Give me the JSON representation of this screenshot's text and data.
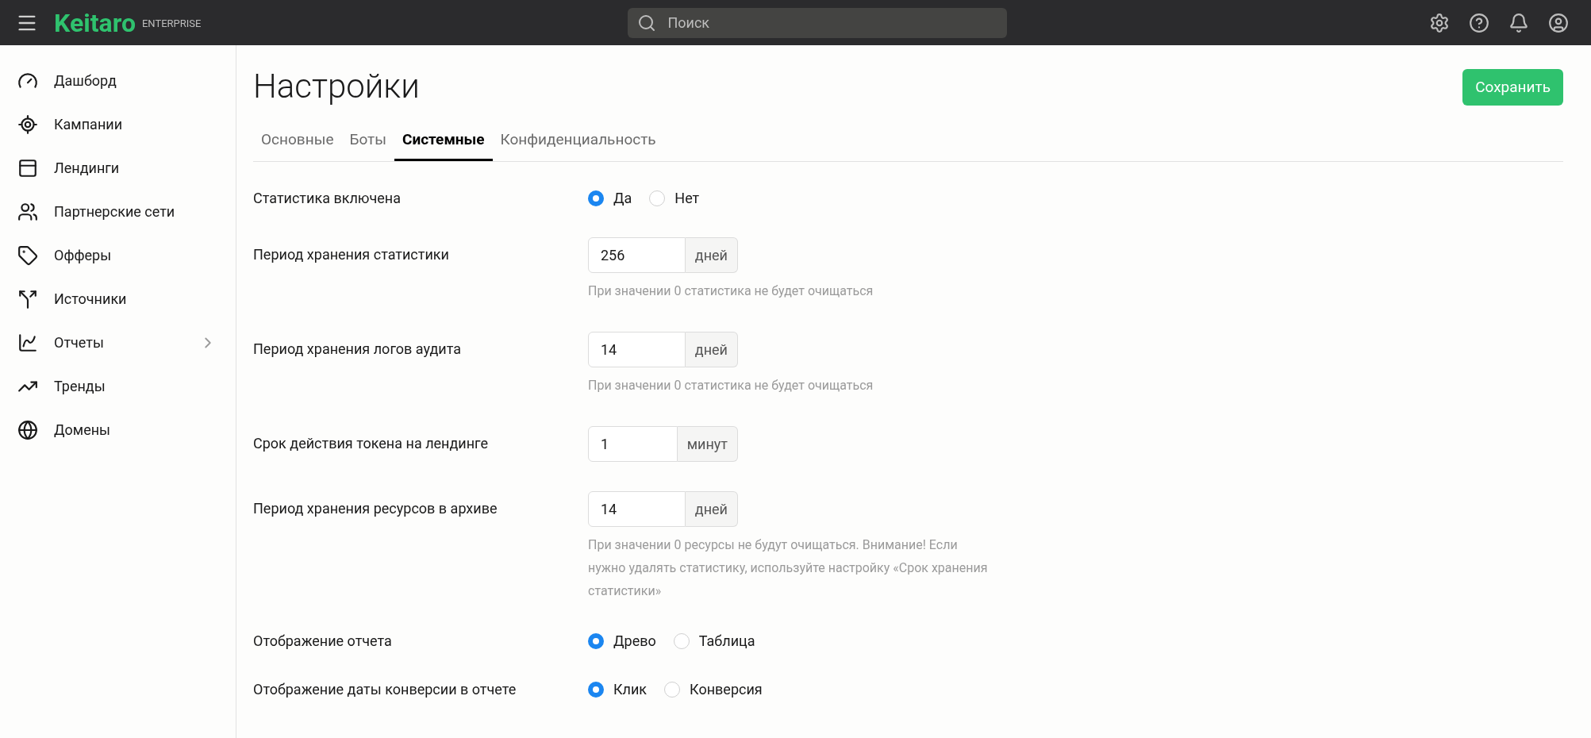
{
  "header": {
    "logo": "Keitaro",
    "edition": "ENTERPRISE",
    "search": {
      "placeholder": "Поиск"
    }
  },
  "sidebar": {
    "items": [
      {
        "label": "Дашборд",
        "expandable": false
      },
      {
        "label": "Кампании",
        "expandable": false
      },
      {
        "label": "Лендинги",
        "expandable": false
      },
      {
        "label": "Партнерские сети",
        "expandable": false
      },
      {
        "label": "Офферы",
        "expandable": false
      },
      {
        "label": "Источники",
        "expandable": false
      },
      {
        "label": "Отчеты",
        "expandable": true
      },
      {
        "label": "Тренды",
        "expandable": false
      },
      {
        "label": "Домены",
        "expandable": false
      }
    ]
  },
  "page": {
    "title": "Настройки",
    "save_button": "Сохранить"
  },
  "tabs": [
    {
      "label": "Основные",
      "selected": false
    },
    {
      "label": "Боты",
      "selected": false
    },
    {
      "label": "Системные",
      "selected": true
    },
    {
      "label": "Конфиденциальность",
      "selected": false
    }
  ],
  "settings": [
    {
      "kind": "radio",
      "label": "Статистика включена",
      "options": [
        {
          "label": "Да",
          "selected": true
        },
        {
          "label": "Нет",
          "selected": false
        }
      ]
    },
    {
      "kind": "number",
      "label": "Период хранения статистики",
      "value": "256",
      "unit": "дней",
      "hint": "При значении 0 статистика не будет очищаться"
    },
    {
      "kind": "number",
      "label": "Период хранения логов аудита",
      "value": "14",
      "unit": "дней",
      "hint": "При значении 0 статистика не будет очищаться"
    },
    {
      "kind": "number",
      "label": "Срок действия токена на лендинге",
      "value": "1",
      "unit": "минут"
    },
    {
      "kind": "number",
      "label": "Период хранения ресурсов в архиве",
      "value": "14",
      "unit": "дней",
      "hint": "При значении 0 ресурсы не будут очищаться. Внимание! Если нужно удалять статистику, используйте настройку «Срок хранения статистики»"
    },
    {
      "kind": "radio",
      "label": "Отображение отчета",
      "options": [
        {
          "label": "Древо",
          "selected": true
        },
        {
          "label": "Таблица",
          "selected": false
        }
      ]
    },
    {
      "kind": "radio",
      "label": "Отображение даты конверсии в отчете",
      "options": [
        {
          "label": "Клик",
          "selected": true
        },
        {
          "label": "Конверсия",
          "selected": false
        }
      ]
    }
  ]
}
